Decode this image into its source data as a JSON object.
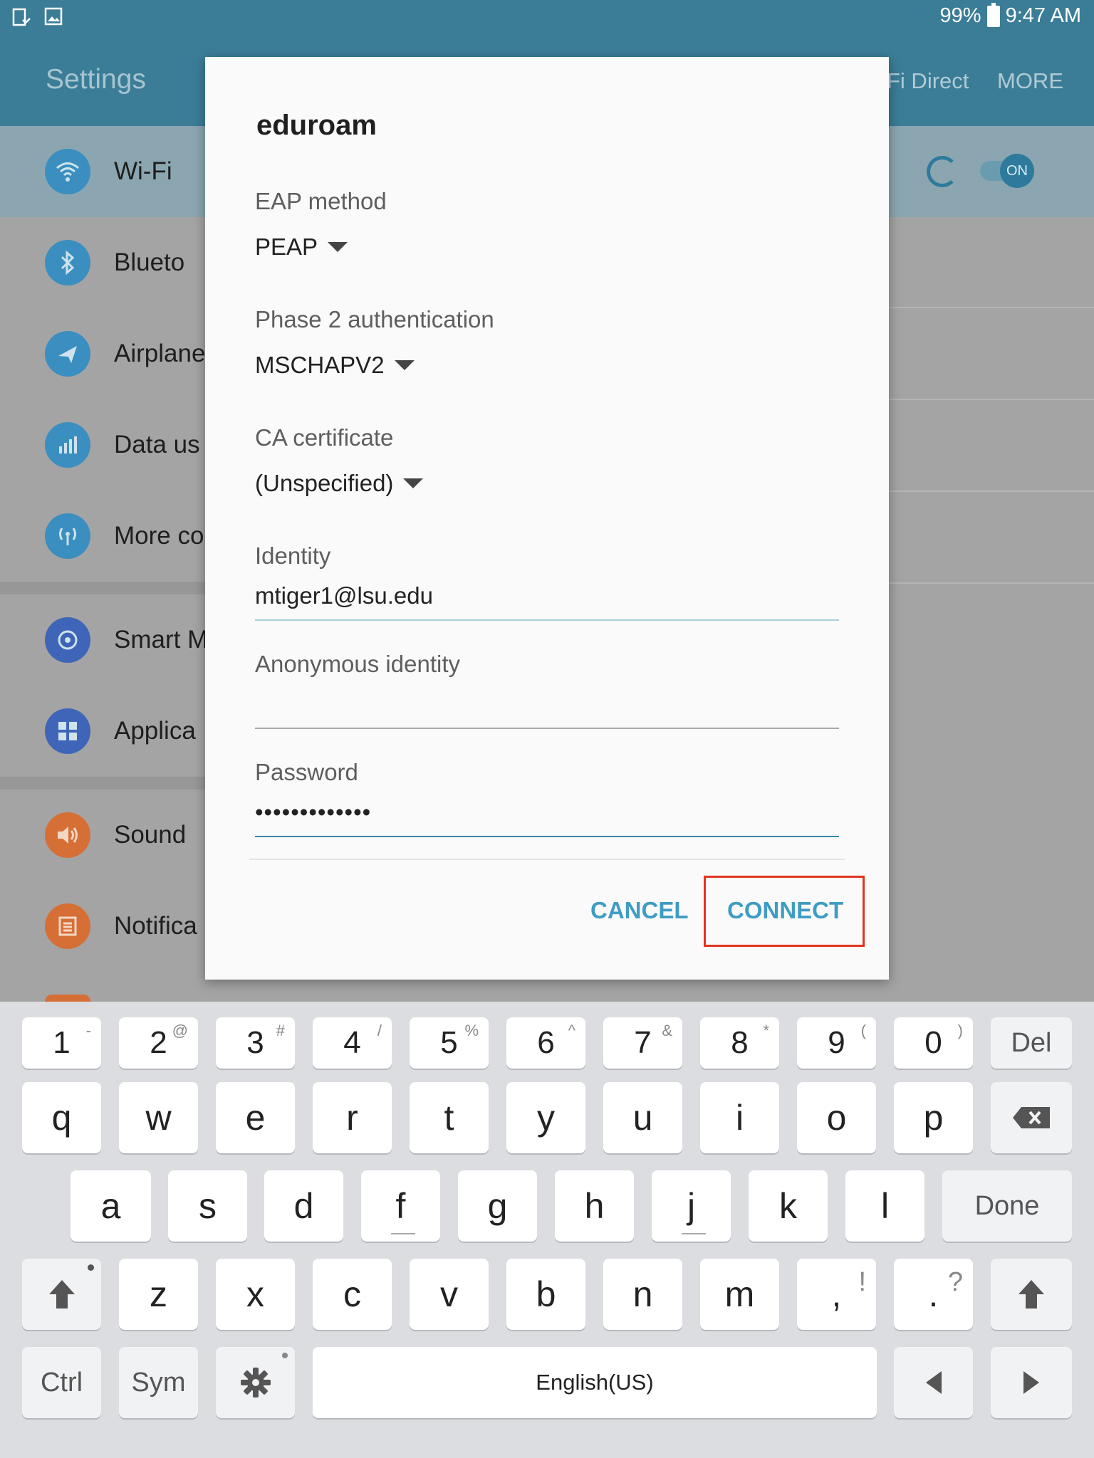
{
  "status_bar": {
    "battery": "99%",
    "time": "9:47 AM"
  },
  "app_bar": {
    "title": "Settings",
    "tab_wifi_direct": "Fi Direct",
    "tab_more": "MORE"
  },
  "settings": {
    "items": [
      {
        "label": "Wi-Fi",
        "icon": "wifi-icon",
        "color": "#3a8fc0"
      },
      {
        "label": "Blueto",
        "icon": "bluetooth-icon",
        "color": "#3a8fc0"
      },
      {
        "label": "Airplane",
        "icon": "airplane-icon",
        "color": "#3a8fc0"
      },
      {
        "label": "Data us",
        "icon": "data-usage-icon",
        "color": "#3a8fc0"
      },
      {
        "label": "More co",
        "icon": "more-connections-icon",
        "color": "#3a8fc0"
      },
      {
        "label": "Smart M",
        "icon": "smart-manager-icon",
        "color": "#3f65b8"
      },
      {
        "label": "Applica",
        "icon": "applications-icon",
        "color": "#3f65b8"
      },
      {
        "label": "Sound",
        "icon": "sound-icon",
        "color": "#d66f35"
      },
      {
        "label": "Notifica",
        "icon": "notifications-icon",
        "color": "#d66f35"
      }
    ],
    "wifi_toggle": "ON"
  },
  "dialog": {
    "title": "eduroam",
    "eap_label": "EAP method",
    "eap_value": "PEAP",
    "phase2_label": "Phase 2 authentication",
    "phase2_value": "MSCHAPV2",
    "ca_label": "CA certificate",
    "ca_value": "(Unspecified)",
    "identity_label": "Identity",
    "identity_value": "mtiger1@lsu.edu",
    "anon_label": "Anonymous identity",
    "anon_value": "",
    "password_label": "Password",
    "password_value": "•••••••••••••",
    "cancel": "CANCEL",
    "connect": "CONNECT",
    "accent_color": "#3f9cc3",
    "highlight_color": "#e2351f"
  },
  "keyboard": {
    "numbers": [
      {
        "main": "1",
        "sub": "-"
      },
      {
        "main": "2",
        "sub": "@"
      },
      {
        "main": "3",
        "sub": "#"
      },
      {
        "main": "4",
        "sub": "/"
      },
      {
        "main": "5",
        "sub": "%"
      },
      {
        "main": "6",
        "sub": "^"
      },
      {
        "main": "7",
        "sub": "&"
      },
      {
        "main": "8",
        "sub": "*"
      },
      {
        "main": "9",
        "sub": "("
      },
      {
        "main": "0",
        "sub": ")"
      }
    ],
    "del": "Del",
    "row1": [
      "q",
      "w",
      "e",
      "r",
      "t",
      "y",
      "u",
      "i",
      "o",
      "p"
    ],
    "row2": [
      "a",
      "s",
      "d",
      "f",
      "g",
      "h",
      "j",
      "k",
      "l"
    ],
    "done": "Done",
    "row3": [
      "z",
      "x",
      "c",
      "v",
      "b",
      "n",
      "m"
    ],
    "comma": {
      "main": ",",
      "sub": "!"
    },
    "period": {
      "main": ".",
      "sub": "?"
    },
    "ctrl": "Ctrl",
    "sym": "Sym",
    "space": "English(US)"
  }
}
